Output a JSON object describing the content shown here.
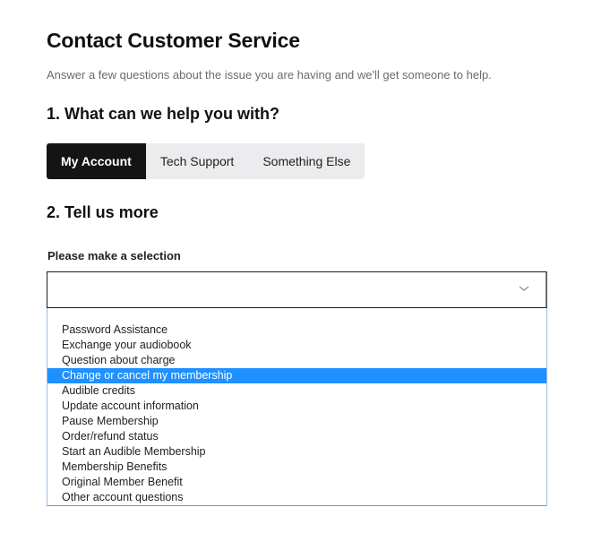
{
  "page": {
    "title": "Contact Customer Service",
    "subtitle": "Answer a few questions about the issue you are having and we'll get someone to help."
  },
  "step1": {
    "heading": "1. What can we help you with?",
    "tabs": [
      {
        "label": "My Account",
        "active": true
      },
      {
        "label": "Tech Support",
        "active": false
      },
      {
        "label": "Something Else",
        "active": false
      }
    ]
  },
  "step2": {
    "heading": "2. Tell us more",
    "select_label": "Please make a selection",
    "select_value": "",
    "chevron_icon": "chevron-down-icon",
    "highlighted_index": 3,
    "options": [
      "Password Assistance",
      "Exchange your audiobook",
      "Question about charge",
      "Change or cancel my membership",
      "Audible credits",
      "Update account information",
      "Pause Membership",
      "Order/refund status",
      "Start an Audible Membership",
      "Membership Benefits",
      "Original Member Benefit",
      "Other account questions"
    ]
  },
  "colors": {
    "active_tab_bg": "#141414",
    "tab_group_bg": "#ececee",
    "highlight": "#1e90ff",
    "dropdown_border": "#9fbde6"
  }
}
